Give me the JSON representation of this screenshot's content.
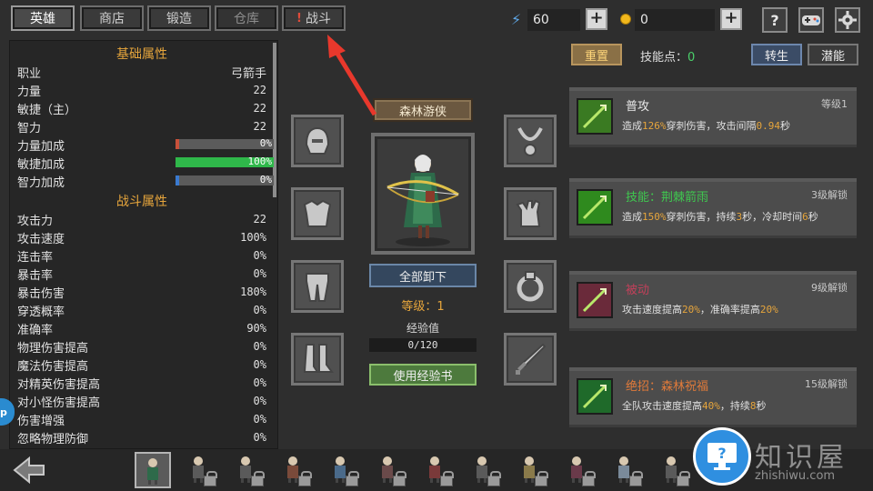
{
  "tabs": [
    {
      "label": "英雄",
      "state": "active"
    },
    {
      "label": "商店",
      "state": "normal"
    },
    {
      "label": "锻造",
      "state": "normal"
    },
    {
      "label": "仓库",
      "state": "dim"
    },
    {
      "label": "战斗",
      "state": "alert",
      "alert_mark": "!"
    }
  ],
  "resources": {
    "energy_icon": "lightning-icon",
    "energy": "60",
    "gold_icon": "coin-icon",
    "gold": "0"
  },
  "top_icons": {
    "help": "?",
    "plus": "+"
  },
  "stats": {
    "base_title": "基础属性",
    "base": [
      {
        "label": "职业",
        "value": "弓箭手"
      },
      {
        "label": "力量",
        "value": "22"
      },
      {
        "label": "敏捷（主）",
        "value": "22"
      },
      {
        "label": "智力",
        "value": "22"
      }
    ],
    "bars": [
      {
        "label": "力量加成",
        "value": "0%",
        "percent": 0,
        "color": "#c8503a"
      },
      {
        "label": "敏捷加成",
        "value": "100%",
        "percent": 100,
        "color": "#2fb84a"
      },
      {
        "label": "智力加成",
        "value": "0%",
        "percent": 0,
        "color": "#3a7ad0"
      }
    ],
    "combat_title": "战斗属性",
    "combat": [
      {
        "label": "攻击力",
        "value": "22"
      },
      {
        "label": "攻击速度",
        "value": "100%"
      },
      {
        "label": "连击率",
        "value": "0%"
      },
      {
        "label": "暴击率",
        "value": "0%"
      },
      {
        "label": "暴击伤害",
        "value": "180%"
      },
      {
        "label": "穿透概率",
        "value": "0%"
      },
      {
        "label": "准确率",
        "value": "90%"
      },
      {
        "label": "物理伤害提高",
        "value": "0%"
      },
      {
        "label": "魔法伤害提高",
        "value": "0%"
      },
      {
        "label": "对精英伤害提高",
        "value": "0%"
      },
      {
        "label": "对小怪伤害提高",
        "value": "0%"
      },
      {
        "label": "伤害增强",
        "value": "0%"
      },
      {
        "label": "忽略物理防御",
        "value": "0%"
      }
    ]
  },
  "hero": {
    "name": "森林游侠",
    "unequip_label": "全部卸下",
    "level_label": "等级：1",
    "exp_label": "经验值",
    "exp_text": "0/120",
    "exp_percent": 0,
    "use_exp_label": "使用经验书"
  },
  "equip_slots": {
    "left": [
      "helmet-slot-icon",
      "armor-slot-icon",
      "pants-slot-icon",
      "boots-slot-icon"
    ],
    "right": [
      "necklace-slot-icon",
      "gloves-slot-icon",
      "ring-slot-icon",
      "weapon-slot-icon"
    ]
  },
  "skills_header": {
    "reset_label": "重置",
    "points_label": "技能点：",
    "points_value": "0",
    "rebirth_label": "转生",
    "potential_label": "潜能"
  },
  "skills": [
    {
      "name": "普攻",
      "name_color": "#e8e8e8",
      "lock": "等级1",
      "icon": "bow-skill-icon",
      "desc": [
        [
          "造成",
          ""
        ],
        [
          "126%",
          "hl"
        ],
        [
          "穿刺伤害，攻击间隔",
          ""
        ],
        [
          "0.94",
          "hl"
        ],
        [
          "秒",
          ""
        ]
      ]
    },
    {
      "name": "技能：荆棘箭雨",
      "name_color": "#3fc84f",
      "lock": "3级解锁",
      "icon": "arrow-rain-skill-icon",
      "desc": [
        [
          "造成",
          ""
        ],
        [
          "150%",
          "hl"
        ],
        [
          "穿刺伤害，持续",
          ""
        ],
        [
          "3",
          "hl"
        ],
        [
          "秒，冷却时间",
          ""
        ],
        [
          "6",
          "hl"
        ],
        [
          "秒",
          ""
        ]
      ]
    },
    {
      "name": "被动",
      "name_color": "#c2405a",
      "lock": "9级解锁",
      "icon": "passive-arrow-icon",
      "desc": [
        [
          "攻击速度提高",
          ""
        ],
        [
          "20%",
          "hl"
        ],
        [
          "，准确率提高",
          ""
        ],
        [
          "20%",
          "hl"
        ]
      ]
    },
    {
      "name": "绝招：森林祝福",
      "name_color": "#e07a3a",
      "lock": "15级解锁",
      "icon": "forest-blessing-icon",
      "desc": [
        [
          "全队攻击速度提高",
          ""
        ],
        [
          "40%",
          "hl"
        ],
        [
          "，持续",
          ""
        ],
        [
          "8",
          "hl"
        ],
        [
          "秒",
          ""
        ]
      ]
    }
  ],
  "side_tab": "p",
  "watermark": {
    "text": "知识屋",
    "sub": "zhishiwu.com",
    "icon": "help-monitor-icon"
  }
}
